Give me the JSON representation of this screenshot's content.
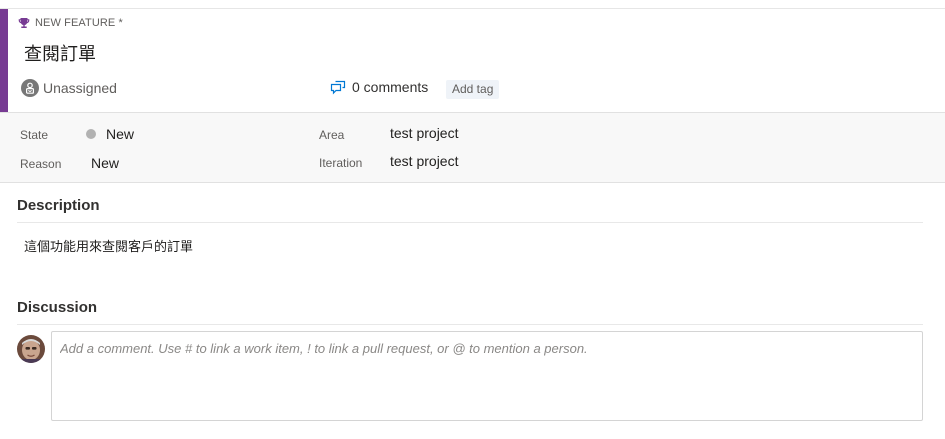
{
  "work_item": {
    "type_label": "NEW FEATURE *",
    "type_icon": "trophy-icon",
    "accent_color": "#773b93",
    "title": "查閱訂單",
    "assignee": "Unassigned",
    "comments_count_label": "0 comments",
    "add_tag_label": "Add tag"
  },
  "fields": {
    "state": {
      "label": "State",
      "value": "New",
      "dot_color": "#b2b2b2"
    },
    "reason": {
      "label": "Reason",
      "value": "New"
    },
    "area": {
      "label": "Area",
      "value": "test project"
    },
    "iteration": {
      "label": "Iteration",
      "value": "test project"
    }
  },
  "description": {
    "heading": "Description",
    "text": "這個功能用來查閱客戶的訂單"
  },
  "discussion": {
    "heading": "Discussion",
    "placeholder": "Add a comment. Use # to link a work item, ! to link a pull request, or @ to mention a person."
  }
}
